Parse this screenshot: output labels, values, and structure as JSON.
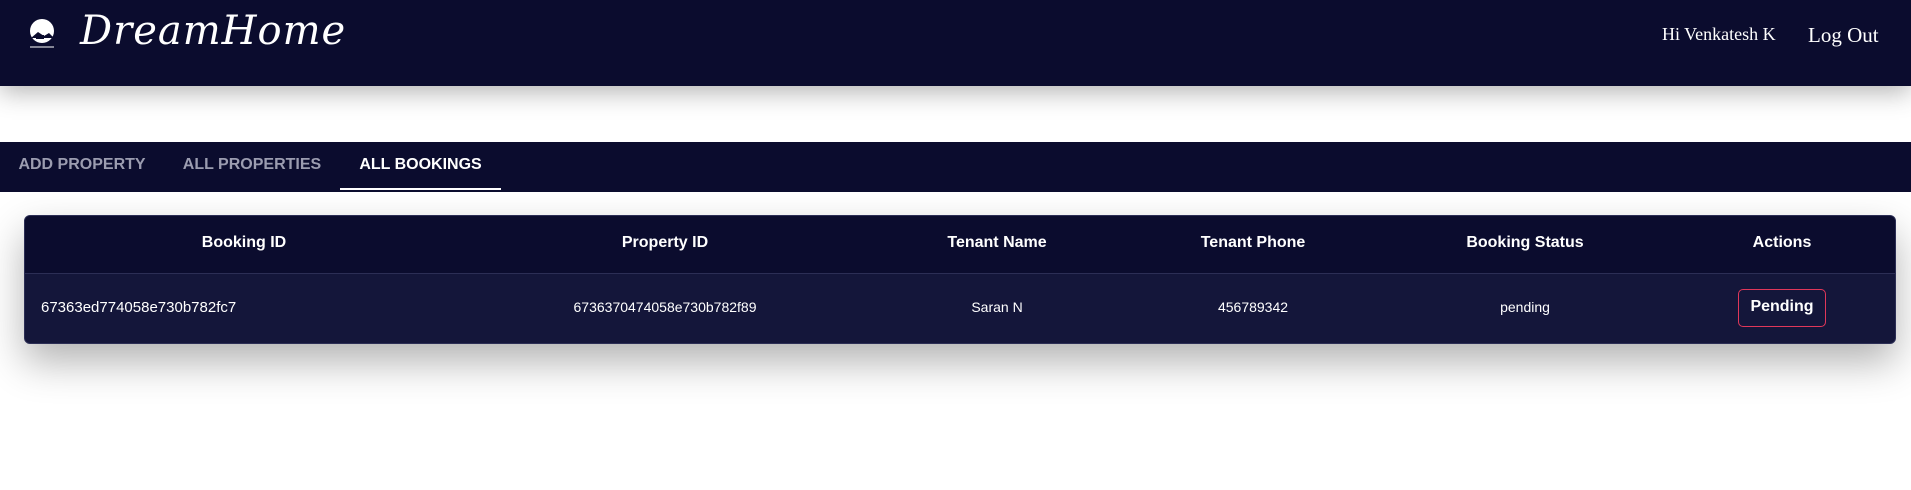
{
  "header": {
    "brand": "DreamHome",
    "brand_subtitle": "Dream Home",
    "greeting": "Hi Venkatesh K",
    "logout_label": "Log Out"
  },
  "tabs": [
    {
      "label": "ADD PROPERTY",
      "active": false
    },
    {
      "label": "ALL PROPERTIES",
      "active": false
    },
    {
      "label": "ALL BOOKINGS",
      "active": true
    }
  ],
  "bookings_table": {
    "columns": [
      "Booking ID",
      "Property ID",
      "Tenant Name",
      "Tenant Phone",
      "Booking Status",
      "Actions"
    ],
    "rows": [
      {
        "booking_id": "67363ed774058e730b782fc7",
        "property_id": "6736370474058e730b782f89",
        "tenant_name": "Saran N",
        "tenant_phone": "456789342",
        "booking_status": "pending",
        "action_label": "Pending"
      }
    ]
  },
  "colors": {
    "navy": "#0b0c2e",
    "row_bg": "#14163a",
    "action_border": "#e0375a",
    "inactive_tab": "#9b9cb0"
  }
}
